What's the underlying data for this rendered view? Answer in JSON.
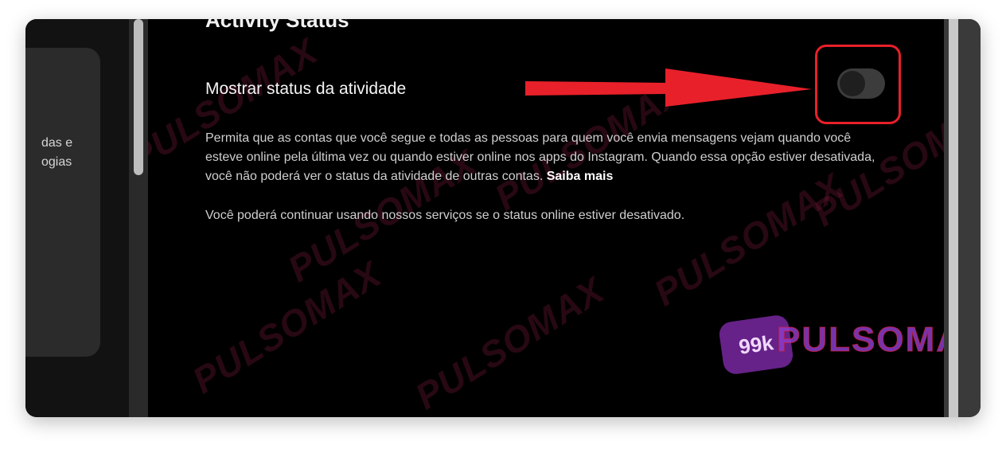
{
  "left_panel": {
    "card_text": "das e\nogias"
  },
  "section": {
    "title": "Activity Status"
  },
  "setting": {
    "label": "Mostrar status da atividade",
    "toggle_state": "off"
  },
  "description": {
    "paragraph1": "Permita que as contas que você segue e todas as pessoas para quem você envia mensagens vejam quando você esteve online pela última vez ou quando estiver online nos apps do Instagram. Quando essa opção estiver desativada, você não poderá ver o status da atividade de outras contas.",
    "link": "Saiba mais",
    "paragraph2": "Você poderá continuar usando nossos serviços se o status online estiver desativado."
  },
  "watermark": {
    "badge": "99k",
    "text": "PULSOMAX"
  },
  "colors": {
    "highlight": "#e8202a",
    "background": "#000000",
    "toggle_track": "#3c3c3c"
  },
  "icons": {
    "arrow": "arrow-right-icon"
  }
}
